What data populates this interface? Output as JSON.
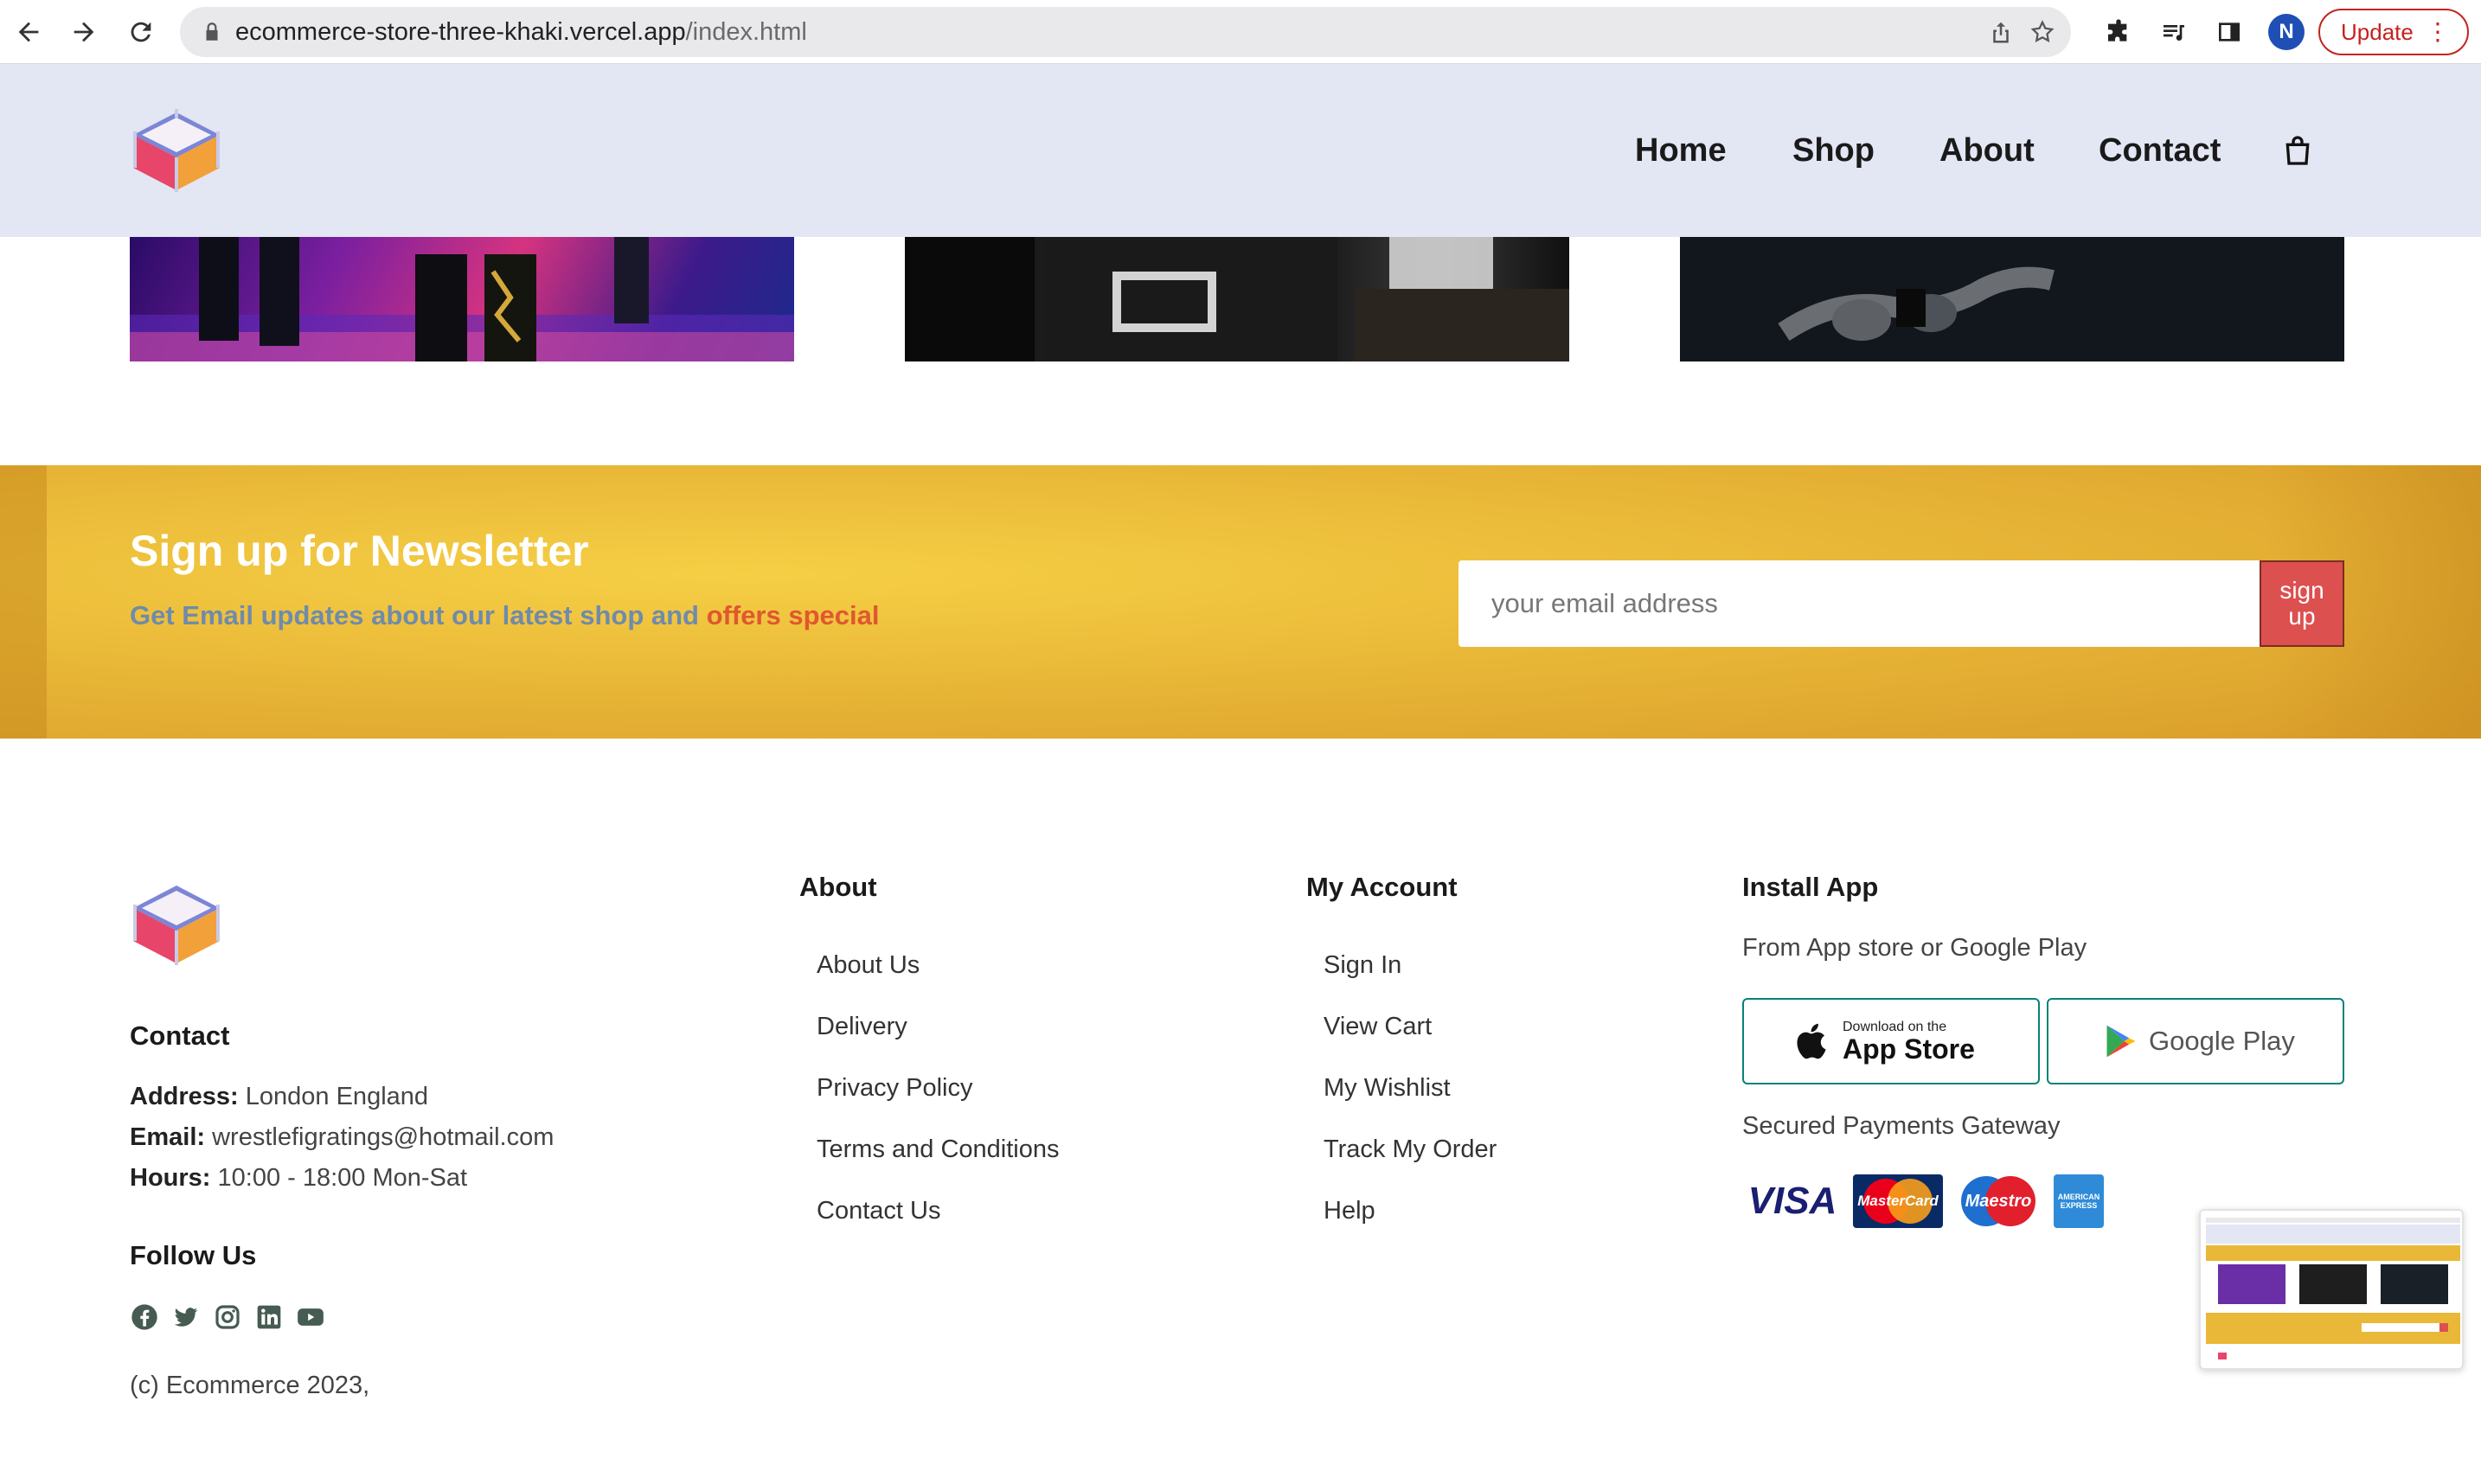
{
  "browser": {
    "url_host": "ecommerce-store-three-khaki.vercel.app",
    "url_path": "/index.html",
    "profile_initial": "N",
    "update_label": "Update",
    "menu_dots": "⋮"
  },
  "header": {
    "nav": [
      {
        "label": "Home"
      },
      {
        "label": "Shop"
      },
      {
        "label": "About"
      },
      {
        "label": "Contact"
      }
    ]
  },
  "newsletter": {
    "title": "Sign up for Newsletter",
    "subtitle_main": "Get Email updates about our latest shop and",
    "subtitle_highlight": "offers special",
    "email_placeholder": "your email address",
    "button_line1": "sign",
    "button_line2": "up"
  },
  "footer": {
    "contact_heading": "Contact",
    "address_label": "Address:",
    "address_value": "London England",
    "email_label": "Email:",
    "email_value": "wrestlefigratings@hotmail.com",
    "hours_label": "Hours:",
    "hours_value": "10:00 - 18:00 Mon-Sat",
    "follow_heading": "Follow Us",
    "copyright": "(c) Ecommerce 2023,",
    "about_heading": "About",
    "about_links": [
      "About Us",
      "Delivery",
      "Privacy Policy",
      "Terms and Conditions",
      "Contact Us"
    ],
    "account_heading": "My Account",
    "account_links": [
      "Sign In",
      "View Cart",
      "My Wishlist",
      "Track My Order",
      "Help"
    ],
    "install_heading": "Install App",
    "install_sub": "From App store or Google Play",
    "appstore_small": "Download on the",
    "appstore_big": "App Store",
    "googleplay_label": "Google Play",
    "secured_label": "Secured Payments Gateway",
    "payment_cards": [
      "VISA",
      "MasterCard",
      "Maestro",
      "AMERICAN EXPRESS"
    ]
  },
  "colors": {
    "header_bg": "#e3e6f3",
    "newsletter_gold": "#e9b838",
    "signup_red": "#dc5050",
    "brand_teal": "#088178",
    "subtitle_blue": "#6f8bab",
    "subtitle_orange": "#e0572f"
  }
}
